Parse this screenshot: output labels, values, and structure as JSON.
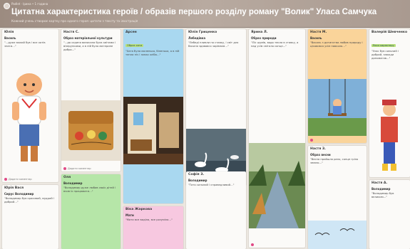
{
  "header": {
    "breadcrumb": "Padlet · Ірина • 1 година",
    "title": "Цитатна характеристика героїв / образів першого розділу роману \"Волик\" Уласа Самчука",
    "subtitle": "Кожний учень створює картку про одного героя: цитати з тексту та ілюстрація"
  },
  "columns": [
    {
      "cards": [
        {
          "author": "Юлія",
          "title": "Василь",
          "body": "\"...дуже малий був і все хотів знати…\"",
          "likes": "Додати коментар",
          "image": "boy-illustration"
        },
        {
          "author": "Юрія Вася",
          "title": "Сирус Володимир",
          "body": "\"Володимир був красивий, мудрий і добрий…\"",
          "likes": ""
        }
      ]
    },
    {
      "cards": [
        {
          "author": "Настя С.",
          "title": "Образ матеріальної культури",
          "body": "\"...да скриня виписана була квітами і візерунками, а в ній було материне добро…\"",
          "likes": "Додати коментар",
          "image": "painted-chest"
        },
        {
          "author": "Оля",
          "title": "Володимир",
          "body": "\"Володимир дуже любив своїх дітей і вчив їх працювати…\"",
          "likes": ""
        }
      ]
    },
    {
      "cards": [
        {
          "author": "Арсен",
          "title": "Образ рідної хати",
          "body": "\"Хата була маленька, біленька, а в ній тепла піч і запах хліба…\"",
          "likes": "",
          "image": "village-house-interior",
          "tag": "Образ хати"
        },
        {
          "author": "Віка Жаркова",
          "title": "Мати",
          "body": "\"Мати все виділа, все розуміла…\"",
          "likes": ""
        }
      ]
    },
    {
      "cards": [
        {
          "author": "Юлія Гриценко",
          "title": "Лебедівка",
          "body": "\"Лебеді пливли по ставку, і світ для Василя здавався чарівним…\"",
          "likes": "",
          "image": "swans-on-lake"
        },
        {
          "author": "Софія З.",
          "title": "Володимир",
          "body": "\"Тато сильний і справедливий…\"",
          "likes": ""
        }
      ]
    },
    {
      "cards": [
        {
          "author": "Ярина Л.",
          "title": "Образ природи",
          "body": "\"Ліс шумів, вода текла в ставку, а над усім світило сонце…\"",
          "likes": "",
          "image": "forest-river"
        }
      ]
    },
    {
      "cards": [
        {
          "author": "Настя М.",
          "title": "Василь",
          "body": "\"Василь з дитинства любив природу і цікавився усім навколо…\"",
          "likes": "",
          "image": "child-on-swing"
        },
        {
          "author": "Настя З.",
          "title": "Образ весни",
          "body": "\"Весна прийшла рано, сонце гріло землю…\"",
          "likes": "",
          "image": "birds-in-sky"
        }
      ]
    },
    {
      "cards": [
        {
          "author": "Валерій Шевченко",
          "title": "Улас",
          "body": "\"Улас був сильний і добрий, завжди допомагав…\"",
          "likes": "",
          "image": "cossack-figure",
          "tag": "Риси характеру"
        },
        {
          "author": "Настя А.",
          "title": "Володимир",
          "body": "\"Володимир був великим…\"",
          "likes": ""
        }
      ]
    }
  ],
  "colors": {
    "header_bg": "#a99a90",
    "card_yellow": "#fde7a8",
    "card_blue": "#a9d8f0",
    "card_green": "#b6e6a8",
    "card_pink": "#f7c8e0",
    "card_white": "#fbfaf8",
    "card_orange": "#fad49a",
    "accent_pink": "#e04a86"
  }
}
